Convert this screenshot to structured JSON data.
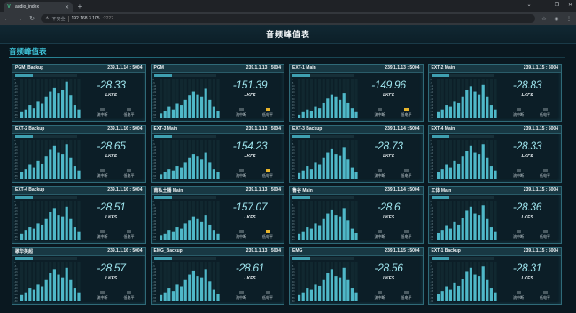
{
  "browser": {
    "tab_title": "audio_index",
    "tab_icon": "vue-logo-icon",
    "security_label": "不安全",
    "url_host": "192.168.3.105",
    "url_port": ":2222"
  },
  "page": {
    "title": "音频峰值表",
    "section_title": "音频峰值表"
  },
  "labels": {
    "unit": "LKFS",
    "flow_interrupt": "流中断",
    "low_level": "低电平"
  },
  "scale_ticks": [
    "0",
    "-5",
    "-10",
    "-15",
    "-20",
    "-25",
    "-30",
    "-35",
    "-40",
    "-45",
    "-50",
    "-55",
    "-60"
  ],
  "colors": {
    "bar": "#4fb8c8",
    "alarm": "#e8b52c",
    "accent": "#3fc3d8"
  },
  "panels": [
    {
      "name": "PGM_Backup",
      "ip": "239.1.1.14 : 5004",
      "value": "-28.33",
      "low": false,
      "bars": [
        4,
        6,
        9,
        7,
        12,
        10,
        15,
        19,
        22,
        18,
        20,
        26,
        16,
        9,
        6
      ]
    },
    {
      "name": "PGM",
      "ip": "239.1.1.13 : 5004",
      "value": "-151.39",
      "low": true,
      "bars": [
        3,
        5,
        8,
        6,
        10,
        9,
        13,
        16,
        19,
        17,
        15,
        21,
        13,
        8,
        5
      ]
    },
    {
      "name": "EXT-1 Main",
      "ip": "239.1.1.13 : 5004",
      "value": "-149.96",
      "low": true,
      "bars": [
        2,
        4,
        6,
        5,
        8,
        7,
        11,
        14,
        17,
        15,
        13,
        18,
        11,
        7,
        4
      ]
    },
    {
      "name": "EXT-2 Main",
      "ip": "239.1.1.15 : 5004",
      "value": "-28.83",
      "low": false,
      "bars": [
        4,
        6,
        9,
        8,
        12,
        11,
        15,
        20,
        23,
        19,
        17,
        24,
        15,
        9,
        6
      ]
    },
    {
      "name": "EXT-2 Backup",
      "ip": "239.1.1.16 : 5004",
      "value": "-28.65",
      "low": false,
      "bars": [
        5,
        7,
        10,
        8,
        13,
        11,
        16,
        21,
        24,
        19,
        18,
        25,
        15,
        9,
        6
      ]
    },
    {
      "name": "EXT-3 Main",
      "ip": "239.1.1.13 : 5004",
      "value": "-154.23",
      "low": true,
      "bars": [
        3,
        5,
        7,
        6,
        9,
        8,
        12,
        15,
        18,
        16,
        14,
        19,
        12,
        7,
        5
      ]
    },
    {
      "name": "EXT-3 Backup",
      "ip": "239.1.1.14 : 5004",
      "value": "-28.73",
      "low": false,
      "bars": [
        4,
        6,
        9,
        7,
        12,
        10,
        15,
        19,
        22,
        18,
        17,
        23,
        14,
        8,
        5
      ]
    },
    {
      "name": "EXT-4 Main",
      "ip": "239.1.1.15 : 5004",
      "value": "-28.33",
      "low": false,
      "bars": [
        5,
        7,
        10,
        8,
        13,
        11,
        16,
        20,
        24,
        19,
        18,
        25,
        15,
        9,
        6
      ]
    },
    {
      "name": "EXT-4 Backup",
      "ip": "239.1.1.16 : 5004",
      "value": "-28.51",
      "low": false,
      "bars": [
        4,
        7,
        9,
        8,
        12,
        11,
        15,
        20,
        23,
        18,
        17,
        24,
        15,
        9,
        6
      ]
    },
    {
      "name": "南私土播 Main",
      "ip": "239.1.1.13 : 5004",
      "value": "-157.07",
      "low": true,
      "bars": [
        3,
        4,
        7,
        6,
        9,
        8,
        12,
        14,
        17,
        15,
        13,
        18,
        11,
        7,
        4
      ]
    },
    {
      "name": "鲁谷 Main",
      "ip": "239.1.1.14 : 5004",
      "value": "-28.6",
      "low": false,
      "bars": [
        4,
        6,
        9,
        8,
        12,
        10,
        15,
        19,
        22,
        18,
        17,
        23,
        14,
        8,
        5
      ]
    },
    {
      "name": "工体 Main",
      "ip": "239.1.1.15 : 5004",
      "value": "-28.36",
      "low": false,
      "bars": [
        5,
        7,
        10,
        8,
        13,
        11,
        16,
        21,
        24,
        19,
        18,
        25,
        15,
        9,
        6
      ]
    },
    {
      "name": "歌华英超",
      "ip": "239.1.1.16 : 5004",
      "value": "-28.57",
      "low": false,
      "bars": [
        4,
        6,
        9,
        8,
        12,
        10,
        15,
        20,
        23,
        19,
        17,
        24,
        15,
        9,
        6
      ]
    },
    {
      "name": "EMG_Backup",
      "ip": "239.1.1.13 : 5004",
      "value": "-28.61",
      "low": false,
      "bars": [
        4,
        6,
        9,
        7,
        12,
        10,
        15,
        19,
        22,
        18,
        17,
        23,
        14,
        8,
        5
      ]
    },
    {
      "name": "EMG",
      "ip": "239.1.1.15 : 5004",
      "value": "-28.56",
      "low": false,
      "bars": [
        4,
        6,
        9,
        8,
        12,
        11,
        15,
        20,
        23,
        18,
        17,
        24,
        15,
        9,
        6
      ]
    },
    {
      "name": "EXT-1 Backup",
      "ip": "239.1.1.15 : 5004",
      "value": "-28.31",
      "low": false,
      "bars": [
        5,
        7,
        10,
        8,
        13,
        11,
        16,
        21,
        24,
        19,
        18,
        25,
        15,
        9,
        6
      ]
    }
  ]
}
